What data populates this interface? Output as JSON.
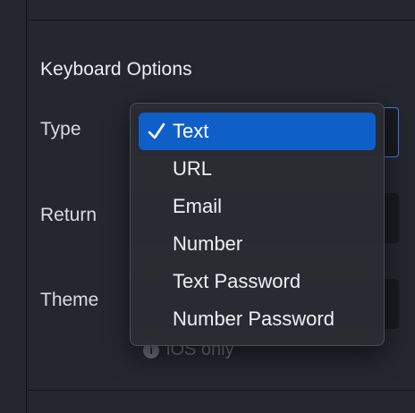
{
  "section": {
    "title": "Keyboard Options"
  },
  "fields": {
    "type_label": "Type",
    "return_label": "Return",
    "theme_label": "Theme"
  },
  "note": {
    "text": "iOS only",
    "icon": "info-icon"
  },
  "dropdown": {
    "selected": "Text",
    "options": [
      "Text",
      "URL",
      "Email",
      "Number",
      "Text Password",
      "Number Password"
    ]
  },
  "colors": {
    "accent": "#0f5fc9",
    "focus_border": "#3b82f6",
    "panel": "#25272e"
  }
}
